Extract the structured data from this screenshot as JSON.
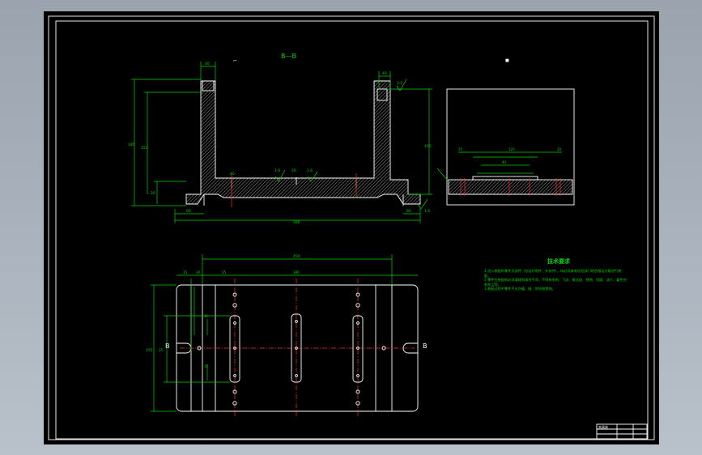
{
  "section_title": "B—B",
  "section_marker": "B",
  "dimensions": {
    "top_left_width": "40",
    "top_right_width": "40",
    "left_total_height": "185",
    "left_inner_height": "150",
    "left_base_height": "20",
    "right_height": "150",
    "bottom_left_offset": "60",
    "bottom_right_offset": "60",
    "base_total_width": "386",
    "center_width": "40",
    "slot_width": "20",
    "plan_total_width": "450",
    "plan_left_a": "35",
    "plan_left_b": "30",
    "plan_left_c": "35",
    "plan_center": "386",
    "plan_height": "155",
    "plan_slot": "35",
    "plan_small": "15",
    "detail_a": "25",
    "detail_b": "120",
    "detail_c": "20",
    "detail_d": "40"
  },
  "roughness": [
    "1.6",
    "1.6",
    "3.2",
    "1.6"
  ],
  "notes": {
    "title": "技术要求",
    "items": [
      "1.进入装配的零件及部件（包括外购件、外协件），均必须具有检验部门的合格证方能进行装配。",
      "2.零件在装配前必须清理和清洗干净，不得有毛刺、飞边、氧化皮、锈蚀、切屑、油污、着色剂和灰尘等。",
      "3.装配过程中零件不允许磕、碰、划伤和锈蚀。"
    ]
  },
  "title_block": {
    "label": "夹具体"
  },
  "colors": {
    "background": "#000000",
    "outline": "#ffffff",
    "dimension": "#00d400",
    "centerline": "#ff2a2a"
  }
}
